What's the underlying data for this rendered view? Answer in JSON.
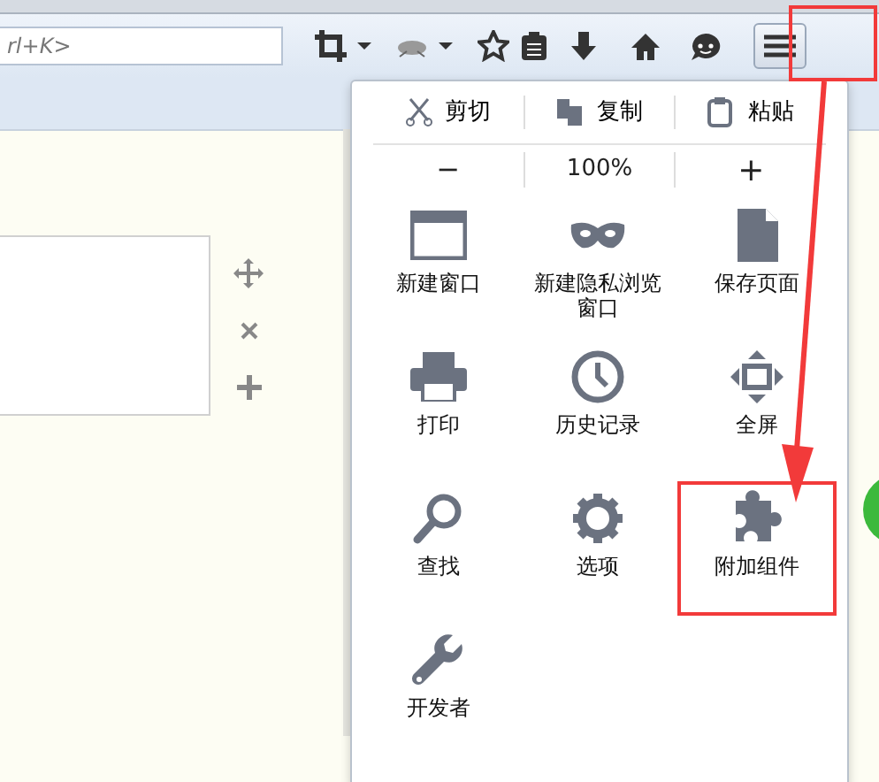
{
  "toolbar": {
    "search": {
      "placeholder": "rl+K>"
    },
    "menu_button": {
      "highlighted": true
    }
  },
  "menu": {
    "edit_row": [
      {
        "kind": "cut",
        "label": "剪切"
      },
      {
        "kind": "copy",
        "label": "复制"
      },
      {
        "kind": "paste",
        "label": "粘贴"
      }
    ],
    "zoom_row": {
      "decrease": "−",
      "level": "100%",
      "increase": "+"
    },
    "items": [
      {
        "kind": "window",
        "label": "新建窗口",
        "highlighted": false
      },
      {
        "kind": "mask",
        "label": "新建隐私浏览窗口",
        "highlighted": false
      },
      {
        "kind": "page",
        "label": "保存页面",
        "highlighted": false
      },
      {
        "kind": "printer",
        "label": "打印",
        "highlighted": false
      },
      {
        "kind": "clock",
        "label": "历史记录",
        "highlighted": false
      },
      {
        "kind": "fullscreen",
        "label": "全屏",
        "highlighted": false
      },
      {
        "kind": "search",
        "label": "查找",
        "highlighted": false
      },
      {
        "kind": "gear",
        "label": "选项",
        "highlighted": false
      },
      {
        "kind": "puzzle",
        "label": "附加组件",
        "highlighted": true
      },
      {
        "kind": "wrench",
        "label": "开发者",
        "highlighted": false
      }
    ]
  }
}
